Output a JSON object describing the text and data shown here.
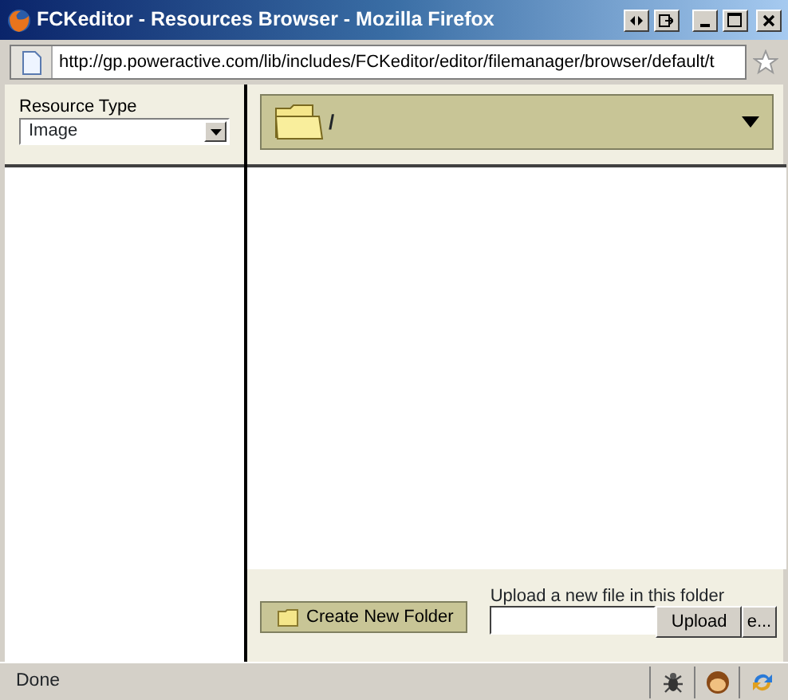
{
  "window": {
    "title": "FCKeditor - Resources Browser - Mozilla Firefox"
  },
  "address_bar": {
    "url": "http://gp.poweractive.com/lib/includes/FCKeditor/editor/filemanager/browser/default/t"
  },
  "resource_type": {
    "label": "Resource Type",
    "value": "Image"
  },
  "folder_bar": {
    "path": "/"
  },
  "create_folder_button": "Create New Folder",
  "upload": {
    "label": "Upload a new file in this folder",
    "button": "Upload",
    "browse_button": "e..."
  },
  "status_bar": {
    "text": "Done"
  }
}
